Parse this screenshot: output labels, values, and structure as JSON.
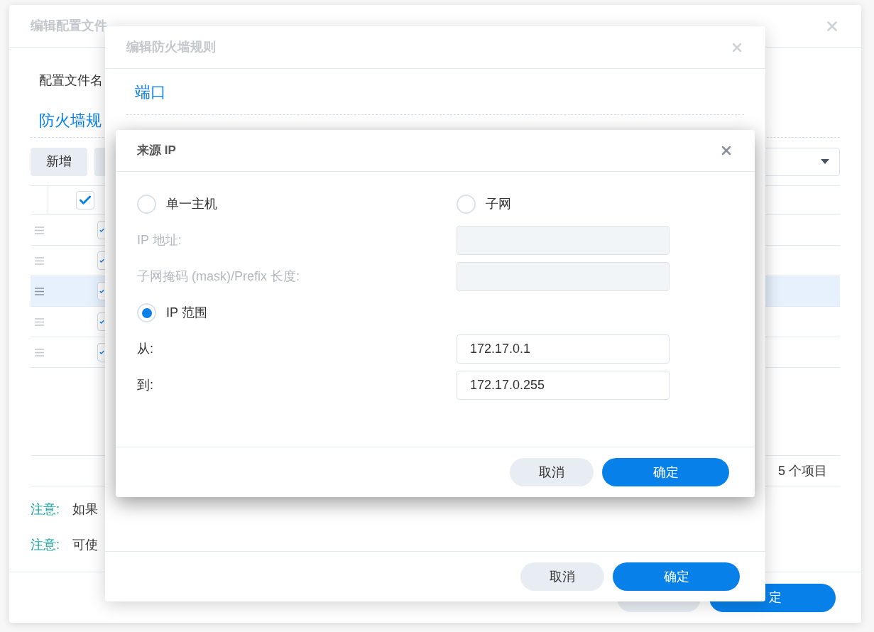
{
  "profile_dialog": {
    "title": "编辑配置文件",
    "profile_name_label": "配置文件名",
    "section_title": "防火墙规",
    "add_button": "新增",
    "header_checked": true,
    "rows": [
      {
        "enabled": true,
        "selected": false
      },
      {
        "enabled": true,
        "selected": false
      },
      {
        "enabled": true,
        "selected": true
      },
      {
        "enabled": true,
        "selected": false
      },
      {
        "enabled": true,
        "selected": false
      }
    ],
    "item_count": "5 个项目",
    "notes": [
      {
        "label": "注意:",
        "text": "如果"
      },
      {
        "label": "注意:",
        "text": "可使"
      }
    ],
    "buttons": [
      {
        "kind": "secondary"
      },
      {
        "label": "定",
        "kind": "primary"
      }
    ]
  },
  "rule_dialog": {
    "title": "编辑防火墙规则",
    "section_title": "端口",
    "buttons": [
      {
        "label": "取消",
        "kind": "secondary"
      },
      {
        "label": "确定",
        "kind": "primary"
      }
    ]
  },
  "source_ip_dialog": {
    "title": "来源 IP",
    "options": [
      {
        "label": "单一主机",
        "selected": false
      },
      {
        "label": "子网",
        "selected": false
      },
      {
        "label": "IP 范围",
        "selected": true
      }
    ],
    "fields": [
      {
        "label": "IP 地址:",
        "disabled": true
      },
      {
        "label": "子网掩码 (mask)/Prefix 长度:",
        "disabled": true
      },
      {
        "label": "从:",
        "value": "172.17.0.1",
        "disabled": false
      },
      {
        "label": "到:",
        "value": "172.17.0.255",
        "disabled": false
      }
    ],
    "buttons": [
      {
        "label": "取消",
        "kind": "secondary"
      },
      {
        "label": "确定",
        "kind": "primary"
      }
    ]
  }
}
